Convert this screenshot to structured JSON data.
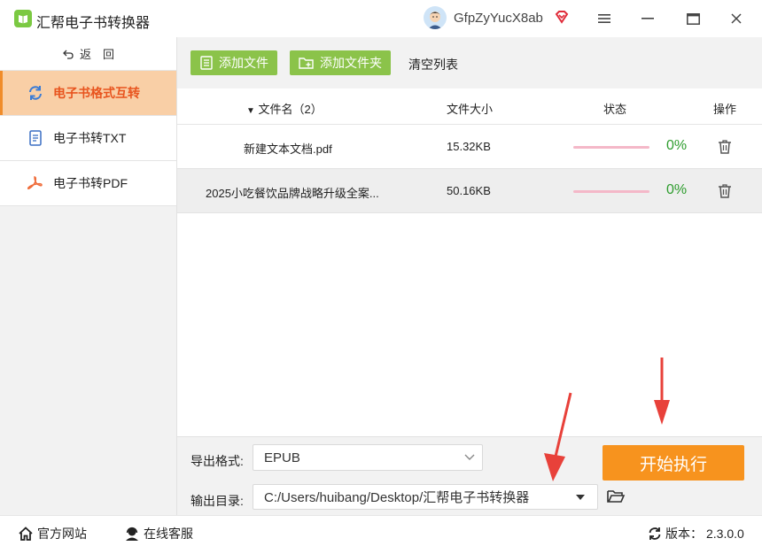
{
  "app": {
    "title": "汇帮电子书转换器",
    "username": "GfpZyYucX8ab"
  },
  "sidebar": {
    "back_label": "返　回",
    "items": [
      {
        "label": "电子书格式互转",
        "icon": "refresh-icon",
        "active": true
      },
      {
        "label": "电子书转TXT",
        "icon": "document-icon",
        "active": false
      },
      {
        "label": "电子书转PDF",
        "icon": "pdf-icon",
        "active": false
      }
    ]
  },
  "toolbar": {
    "add_file": "添加文件",
    "add_folder": "添加文件夹",
    "clear_list": "清空列表"
  },
  "table": {
    "headers": {
      "name": "文件名（2）",
      "size": "文件大小",
      "status": "状态",
      "action": "操作"
    },
    "rows": [
      {
        "name": "新建文本文档.pdf",
        "size": "15.32KB",
        "progress": "0%"
      },
      {
        "name": "2025小吃餐饮品牌战略升级全案...",
        "size": "50.16KB",
        "progress": "0%"
      }
    ]
  },
  "settings": {
    "format_label": "导出格式:",
    "format_value": "EPUB",
    "dir_label": "输出目录:",
    "dir_value": "C:/Users/huibang/Desktop/汇帮电子书转换器",
    "start_label": "开始执行"
  },
  "statusbar": {
    "website": "官方网站",
    "support": "在线客服",
    "version_label": "版本：",
    "version": "2.3.0.0"
  },
  "colors": {
    "accent_orange": "#f7931e",
    "green": "#8bc34a",
    "active_nav_bg": "#f9cfa6",
    "active_nav_text": "#e8541e",
    "arrow_red": "#e8413a"
  }
}
